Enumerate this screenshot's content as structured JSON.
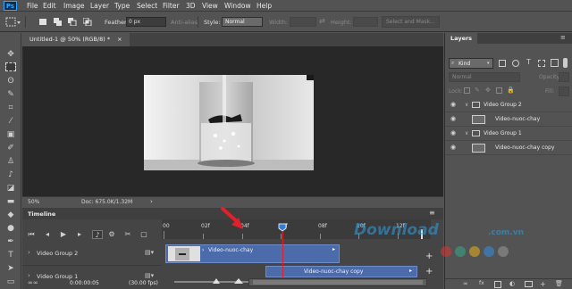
{
  "menubar": {
    "logo": "Ps",
    "items": [
      "File",
      "Edit",
      "Image",
      "Layer",
      "Type",
      "Select",
      "Filter",
      "3D",
      "View",
      "Window",
      "Help"
    ]
  },
  "options_bar": {
    "feather_label": "Feather:",
    "feather_value": "0 px",
    "antialias_label": "Anti-alias",
    "style_label": "Style:",
    "style_value": "Normal",
    "width_label": "Width:",
    "height_label": "Height:",
    "select_mask_label": "Select and Mask..."
  },
  "document": {
    "tab_title": "Untitled-1 @ 50% (RGB/8) *",
    "close": "×"
  },
  "status": {
    "zoom": "50%",
    "doc_size": "Doc: 675.0K/1.32M"
  },
  "timeline": {
    "title": "Timeline",
    "ruler_labels": [
      "00",
      "02f",
      "04f",
      "06f",
      "08f",
      "10f",
      "12f"
    ],
    "tracks": [
      {
        "label": "Video Group 2"
      },
      {
        "label": "Video Group 1"
      }
    ],
    "clips": [
      "Video-nuoc-chay",
      "Video-nuoc-chay copy"
    ],
    "timecode": "0:00:00:05",
    "fps": "(30.00 fps)"
  },
  "layers_panel": {
    "title": "Layers",
    "filter_kind": "Kind",
    "blend_mode": "Normal",
    "opacity_label": "Opacity:",
    "lock_label": "Lock:",
    "fill_label": "Fill:",
    "layers": [
      {
        "name": "Video Group 2",
        "type": "group"
      },
      {
        "name": "Video-nuoc-chay",
        "type": "video"
      },
      {
        "name": "Video Group 1",
        "type": "group"
      },
      {
        "name": "Video-nuoc-chay copy",
        "type": "video"
      }
    ]
  },
  "watermark": {
    "brand": "Download",
    "suffix": ".com.vn"
  },
  "colors": {
    "ui_bg": "#535353",
    "canvas_bg": "#282828",
    "clip_blue": "#4b6bab",
    "playhead_red": "#e0202a",
    "accent_blue": "#31a8ff"
  }
}
